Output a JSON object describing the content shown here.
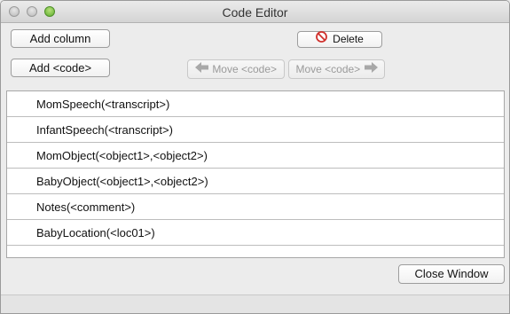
{
  "window": {
    "title": "Code Editor"
  },
  "toolbar": {
    "add_column": "Add column",
    "add_code": "Add <code>",
    "delete": "Delete",
    "move_left": "Move <code>",
    "move_right": "Move <code>"
  },
  "codes": [
    {
      "label": "MomSpeech(<transcript>)"
    },
    {
      "label": "InfantSpeech(<transcript>)"
    },
    {
      "label": "MomObject(<object1>,<object2>)"
    },
    {
      "label": "BabyObject(<object1>,<object2>)"
    },
    {
      "label": "Notes(<comment>)"
    },
    {
      "label": "BabyLocation(<loc01>)"
    }
  ],
  "footer": {
    "close_window": "Close Window"
  },
  "icons": {
    "delete": "no-entry-icon",
    "move_left": "arrow-left-icon",
    "move_right": "arrow-right-icon"
  },
  "colors": {
    "delete_icon": "#d0312d",
    "max_button": "#5fae2e"
  }
}
